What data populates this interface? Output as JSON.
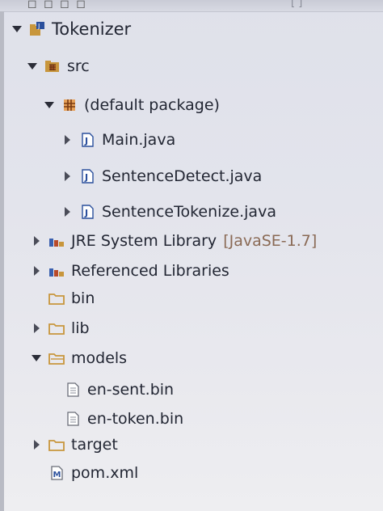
{
  "tree": {
    "project": "Tokenizer",
    "src": "src",
    "default_package": "(default package)",
    "files": [
      "Main.java",
      "SentenceDetect.java",
      "SentenceTokenize.java"
    ],
    "jre": {
      "label": "JRE System Library",
      "decoration": "[JavaSE-1.7]"
    },
    "ref_libs": "Referenced Libraries",
    "bin": "bin",
    "lib": "lib",
    "models": "models",
    "model_files": [
      "en-sent.bin",
      "en-token.bin"
    ],
    "target": "target",
    "pom": "pom.xml"
  },
  "colors": {
    "java_icon": "#2a4f9c",
    "package_icon": "#b8662a",
    "folder_icon": "#c8963c",
    "decoration": "#8a6a55"
  }
}
